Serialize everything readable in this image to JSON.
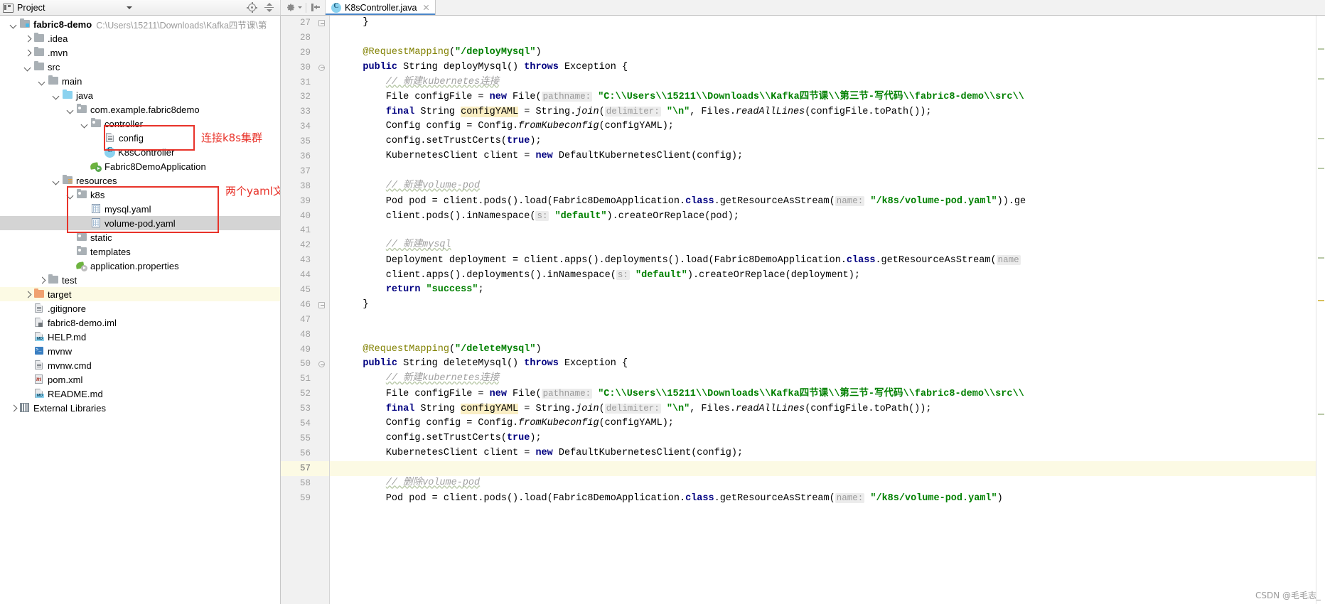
{
  "window": {
    "project_panel_title": "Project",
    "tools": [
      "locate-icon",
      "collapse-all-icon",
      "gear-icon",
      "hide-panel-icon"
    ]
  },
  "editor_tab": {
    "label": "K8sController.java",
    "icon": "java-class-icon",
    "close": "×"
  },
  "tree": {
    "root": {
      "label": "fabric8-demo",
      "path": "C:\\Users\\15211\\Downloads\\Kafka四节课\\第"
    },
    "items": [
      {
        "label": ".idea",
        "indent": 1,
        "twisty": "right",
        "icon": "folder"
      },
      {
        "label": ".mvn",
        "indent": 1,
        "twisty": "right",
        "icon": "folder"
      },
      {
        "label": "src",
        "indent": 1,
        "twisty": "down",
        "icon": "folder"
      },
      {
        "label": "main",
        "indent": 2,
        "twisty": "down",
        "icon": "folder"
      },
      {
        "label": "java",
        "indent": 3,
        "twisty": "down",
        "icon": "folder-blue"
      },
      {
        "label": "com.example.fabric8demo",
        "indent": 4,
        "twisty": "down",
        "icon": "package"
      },
      {
        "label": "controller",
        "indent": 5,
        "twisty": "down",
        "icon": "package"
      },
      {
        "label": "config",
        "indent": 6,
        "twisty": "none",
        "icon": "text-file"
      },
      {
        "label": "K8sController",
        "indent": 6,
        "twisty": "none",
        "icon": "java-class"
      },
      {
        "label": "Fabric8DemoApplication",
        "indent": 5,
        "twisty": "none",
        "icon": "spring-boot-run"
      },
      {
        "label": "resources",
        "indent": 3,
        "twisty": "down",
        "icon": "folder-resources"
      },
      {
        "label": "k8s",
        "indent": 4,
        "twisty": "down",
        "icon": "package"
      },
      {
        "label": "mysql.yaml",
        "indent": 5,
        "twisty": "none",
        "icon": "yaml-file"
      },
      {
        "label": "volume-pod.yaml",
        "indent": 5,
        "twisty": "none",
        "icon": "yaml-file",
        "state": "selected"
      },
      {
        "label": "static",
        "indent": 4,
        "twisty": "none",
        "icon": "package"
      },
      {
        "label": "templates",
        "indent": 4,
        "twisty": "none",
        "icon": "package"
      },
      {
        "label": "application.properties",
        "indent": 4,
        "twisty": "none",
        "icon": "spring-properties"
      },
      {
        "label": "test",
        "indent": 2,
        "twisty": "right",
        "icon": "folder"
      },
      {
        "label": "target",
        "indent": 1,
        "twisty": "right",
        "icon": "folder-orange",
        "state": "highlighted"
      },
      {
        "label": ".gitignore",
        "indent": 1,
        "twisty": "none",
        "icon": "text-file"
      },
      {
        "label": "fabric8-demo.iml",
        "indent": 1,
        "twisty": "none",
        "icon": "iml-file"
      },
      {
        "label": "HELP.md",
        "indent": 1,
        "twisty": "none",
        "icon": "markdown-file"
      },
      {
        "label": "mvnw",
        "indent": 1,
        "twisty": "none",
        "icon": "shell-file"
      },
      {
        "label": "mvnw.cmd",
        "indent": 1,
        "twisty": "none",
        "icon": "text-file"
      },
      {
        "label": "pom.xml",
        "indent": 1,
        "twisty": "none",
        "icon": "maven-file"
      },
      {
        "label": "README.md",
        "indent": 1,
        "twisty": "none",
        "icon": "markdown-file"
      },
      {
        "label": "External Libraries",
        "indent": 0,
        "twisty": "right",
        "icon": "library"
      }
    ]
  },
  "annotations": {
    "color": "#e8332a",
    "items": [
      {
        "text": "连接k8s集群"
      },
      {
        "text": "两个yaml文件写在这里"
      }
    ]
  },
  "code": {
    "first_line": 27,
    "current_line": 57,
    "lines": [
      {
        "n": 27,
        "fold": "end",
        "tokens": [
          {
            "t": "plain",
            "v": "    }"
          }
        ]
      },
      {
        "n": 28,
        "tokens": []
      },
      {
        "n": 29,
        "tokens": [
          {
            "t": "plain",
            "v": "    "
          },
          {
            "t": "ann",
            "v": "@RequestMapping"
          },
          {
            "t": "plain",
            "v": "("
          },
          {
            "t": "str",
            "v": "\"/deployMysql\""
          },
          {
            "t": "plain",
            "v": ")"
          }
        ]
      },
      {
        "n": 30,
        "fold": "start",
        "tokens": [
          {
            "t": "plain",
            "v": "    "
          },
          {
            "t": "kw",
            "v": "public"
          },
          {
            "t": "plain",
            "v": " String deployMysql() "
          },
          {
            "t": "kw",
            "v": "throws"
          },
          {
            "t": "plain",
            "v": " Exception {"
          }
        ]
      },
      {
        "n": 31,
        "tokens": [
          {
            "t": "plain",
            "v": "        "
          },
          {
            "t": "cmt",
            "v": "// 新建kubernetes连接"
          }
        ]
      },
      {
        "n": 32,
        "tokens": [
          {
            "t": "plain",
            "v": "        File configFile = "
          },
          {
            "t": "kw",
            "v": "new"
          },
          {
            "t": "plain",
            "v": " File("
          },
          {
            "t": "hint",
            "v": "pathname:"
          },
          {
            "t": "plain",
            "v": " "
          },
          {
            "t": "str",
            "v": "\"C:\\\\Users\\\\15211\\\\Downloads\\\\Kafka四节课\\\\第三节-写代码\\\\fabric8-demo\\\\src\\\\"
          }
        ]
      },
      {
        "n": 33,
        "tokens": [
          {
            "t": "plain",
            "v": "        "
          },
          {
            "t": "kw",
            "v": "final"
          },
          {
            "t": "plain",
            "v": " String "
          },
          {
            "t": "hl",
            "v": "configYAML"
          },
          {
            "t": "plain",
            "v": " = String."
          },
          {
            "t": "mth",
            "v": "join"
          },
          {
            "t": "plain",
            "v": "("
          },
          {
            "t": "hint",
            "v": "delimiter:"
          },
          {
            "t": "plain",
            "v": " "
          },
          {
            "t": "str",
            "v": "\"\\n\""
          },
          {
            "t": "plain",
            "v": ", Files."
          },
          {
            "t": "mth",
            "v": "readAllLines"
          },
          {
            "t": "plain",
            "v": "(configFile.toPath());"
          }
        ]
      },
      {
        "n": 34,
        "tokens": [
          {
            "t": "plain",
            "v": "        Config config = Config."
          },
          {
            "t": "mth",
            "v": "fromKubeconfig"
          },
          {
            "t": "plain",
            "v": "(configYAML);"
          }
        ]
      },
      {
        "n": 35,
        "tokens": [
          {
            "t": "plain",
            "v": "        config.setTrustCerts("
          },
          {
            "t": "kw",
            "v": "true"
          },
          {
            "t": "plain",
            "v": ");"
          }
        ]
      },
      {
        "n": 36,
        "tokens": [
          {
            "t": "plain",
            "v": "        KubernetesClient client = "
          },
          {
            "t": "kw",
            "v": "new"
          },
          {
            "t": "plain",
            "v": " DefaultKubernetesClient(config);"
          }
        ]
      },
      {
        "n": 37,
        "tokens": []
      },
      {
        "n": 38,
        "tokens": [
          {
            "t": "plain",
            "v": "        "
          },
          {
            "t": "cmt",
            "v": "// 新建volume-pod"
          }
        ]
      },
      {
        "n": 39,
        "tokens": [
          {
            "t": "plain",
            "v": "        Pod pod = client.pods().load(Fabric8DemoApplication."
          },
          {
            "t": "kw",
            "v": "class"
          },
          {
            "t": "plain",
            "v": ".getResourceAsStream("
          },
          {
            "t": "hint",
            "v": "name:"
          },
          {
            "t": "plain",
            "v": " "
          },
          {
            "t": "str",
            "v": "\"/k8s/volume-pod.yaml\""
          },
          {
            "t": "plain",
            "v": ")).ge"
          }
        ]
      },
      {
        "n": 40,
        "tokens": [
          {
            "t": "plain",
            "v": "        client.pods().inNamespace("
          },
          {
            "t": "hint",
            "v": "s:"
          },
          {
            "t": "plain",
            "v": " "
          },
          {
            "t": "str",
            "v": "\"default\""
          },
          {
            "t": "plain",
            "v": ").createOrReplace(pod);"
          }
        ]
      },
      {
        "n": 41,
        "tokens": []
      },
      {
        "n": 42,
        "tokens": [
          {
            "t": "plain",
            "v": "        "
          },
          {
            "t": "cmt",
            "v": "// 新建mysql"
          }
        ]
      },
      {
        "n": 43,
        "tokens": [
          {
            "t": "plain",
            "v": "        Deployment deployment = client.apps().deployments().load(Fabric8DemoApplication."
          },
          {
            "t": "kw",
            "v": "class"
          },
          {
            "t": "plain",
            "v": ".getResourceAsStream("
          },
          {
            "t": "hint",
            "v": "name"
          }
        ]
      },
      {
        "n": 44,
        "tokens": [
          {
            "t": "plain",
            "v": "        client.apps().deployments().inNamespace("
          },
          {
            "t": "hint",
            "v": "s:"
          },
          {
            "t": "plain",
            "v": " "
          },
          {
            "t": "str",
            "v": "\"default\""
          },
          {
            "t": "plain",
            "v": ").createOrReplace(deployment);"
          }
        ]
      },
      {
        "n": 45,
        "tokens": [
          {
            "t": "plain",
            "v": "        "
          },
          {
            "t": "kw",
            "v": "return"
          },
          {
            "t": "plain",
            "v": " "
          },
          {
            "t": "str",
            "v": "\"success\""
          },
          {
            "t": "plain",
            "v": ";"
          }
        ]
      },
      {
        "n": 46,
        "fold": "end",
        "tokens": [
          {
            "t": "plain",
            "v": "    }"
          }
        ]
      },
      {
        "n": 47,
        "tokens": []
      },
      {
        "n": 48,
        "tokens": []
      },
      {
        "n": 49,
        "tokens": [
          {
            "t": "plain",
            "v": "    "
          },
          {
            "t": "ann",
            "v": "@RequestMapping"
          },
          {
            "t": "plain",
            "v": "("
          },
          {
            "t": "str",
            "v": "\"/deleteMysql\""
          },
          {
            "t": "plain",
            "v": ")"
          }
        ]
      },
      {
        "n": 50,
        "fold": "start",
        "tokens": [
          {
            "t": "plain",
            "v": "    "
          },
          {
            "t": "kw",
            "v": "public"
          },
          {
            "t": "plain",
            "v": " String deleteMysql() "
          },
          {
            "t": "kw",
            "v": "throws"
          },
          {
            "t": "plain",
            "v": " Exception {"
          }
        ]
      },
      {
        "n": 51,
        "tokens": [
          {
            "t": "plain",
            "v": "        "
          },
          {
            "t": "cmt",
            "v": "// 新建kubernetes连接"
          }
        ]
      },
      {
        "n": 52,
        "tokens": [
          {
            "t": "plain",
            "v": "        File configFile = "
          },
          {
            "t": "kw",
            "v": "new"
          },
          {
            "t": "plain",
            "v": " File("
          },
          {
            "t": "hint",
            "v": "pathname:"
          },
          {
            "t": "plain",
            "v": " "
          },
          {
            "t": "str",
            "v": "\"C:\\\\Users\\\\15211\\\\Downloads\\\\Kafka四节课\\\\第三节-写代码\\\\fabric8-demo\\\\src\\\\"
          }
        ]
      },
      {
        "n": 53,
        "tokens": [
          {
            "t": "plain",
            "v": "        "
          },
          {
            "t": "kw",
            "v": "final"
          },
          {
            "t": "plain",
            "v": " String "
          },
          {
            "t": "hl",
            "v": "configYAML"
          },
          {
            "t": "plain",
            "v": " = String."
          },
          {
            "t": "mth",
            "v": "join"
          },
          {
            "t": "plain",
            "v": "("
          },
          {
            "t": "hint",
            "v": "delimiter:"
          },
          {
            "t": "plain",
            "v": " "
          },
          {
            "t": "str",
            "v": "\"\\n\""
          },
          {
            "t": "plain",
            "v": ", Files."
          },
          {
            "t": "mth",
            "v": "readAllLines"
          },
          {
            "t": "plain",
            "v": "(configFile.toPath());"
          }
        ]
      },
      {
        "n": 54,
        "tokens": [
          {
            "t": "plain",
            "v": "        Config config = Config."
          },
          {
            "t": "mth",
            "v": "fromKubeconfig"
          },
          {
            "t": "plain",
            "v": "(configYAML);"
          }
        ]
      },
      {
        "n": 55,
        "tokens": [
          {
            "t": "plain",
            "v": "        config.setTrustCerts("
          },
          {
            "t": "kw",
            "v": "true"
          },
          {
            "t": "plain",
            "v": ");"
          }
        ]
      },
      {
        "n": 56,
        "tokens": [
          {
            "t": "plain",
            "v": "        KubernetesClient client = "
          },
          {
            "t": "kw",
            "v": "new"
          },
          {
            "t": "plain",
            "v": " DefaultKubernetesClient(config);"
          }
        ]
      },
      {
        "n": 57,
        "current": true,
        "tokens": []
      },
      {
        "n": 58,
        "tokens": [
          {
            "t": "plain",
            "v": "        "
          },
          {
            "t": "cmt",
            "v": "// 删除volume-pod"
          }
        ]
      },
      {
        "n": 59,
        "tokens": [
          {
            "t": "plain",
            "v": "        Pod pod = client.pods().load(Fabric8DemoApplication."
          },
          {
            "t": "kw",
            "v": "class"
          },
          {
            "t": "plain",
            "v": ".getResourceAsStream("
          },
          {
            "t": "hint",
            "v": "name:"
          },
          {
            "t": "plain",
            "v": " "
          },
          {
            "t": "str",
            "v": "\"/k8s/volume-pod.yaml\""
          },
          {
            "t": "plain",
            "v": ")"
          }
        ]
      }
    ]
  },
  "watermark": "CSDN @毛毛志_"
}
